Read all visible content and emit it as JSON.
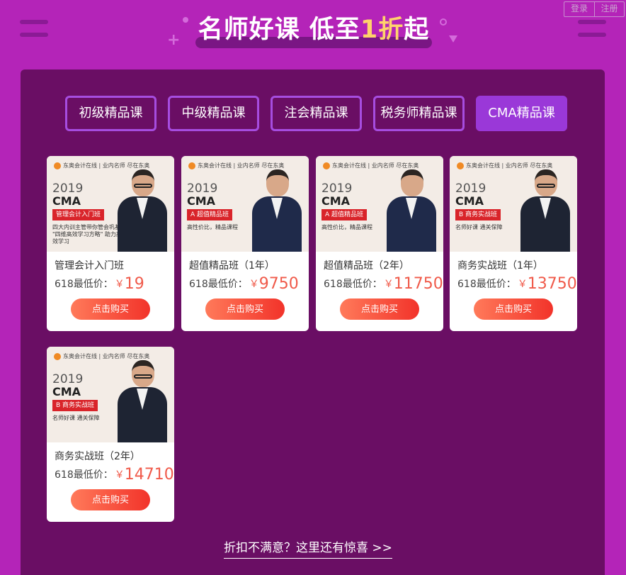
{
  "auth": {
    "login": "登录",
    "register": "注册"
  },
  "headline": {
    "part1": "名师好课 低至",
    "highlight": "1折",
    "part2": "起"
  },
  "tabs": [
    {
      "label": "初级精品课",
      "active": false
    },
    {
      "label": "中级精品课",
      "active": false
    },
    {
      "label": "注会精品课",
      "active": false
    },
    {
      "label": "税务师精品课",
      "active": false
    },
    {
      "label": "CMA精品课",
      "active": true
    }
  ],
  "thumb_common": {
    "logo": "东奥会计在线 | 业内名师 尽在东奥",
    "year": "2019",
    "cma": "CMA"
  },
  "cards": [
    {
      "ribbon": "管理会计入门班",
      "tagline": "四大内训主管带你管会巩基 \"四维高效学习方略\" 助力高效学习",
      "name": "管理会计入门班",
      "price_label": "618最低价：",
      "yen": "￥",
      "price": "19",
      "button": "点击购买"
    },
    {
      "ribbon": "A 超值精品班",
      "tagline": "高性价比，精品课程",
      "name": "超值精品班（1年）",
      "price_label": "618最低价：",
      "yen": "￥",
      "price": "9750",
      "button": "点击购买"
    },
    {
      "ribbon": "A 超值精品班",
      "tagline": "高性价比，精品课程",
      "name": "超值精品班（2年）",
      "price_label": "618最低价：",
      "yen": "￥",
      "price": "11750",
      "button": "点击购买"
    },
    {
      "ribbon": "B 商务实战班",
      "tagline": "名师好课 通关保障",
      "name": "商务实战班（1年）",
      "price_label": "618最低价：",
      "yen": "￥",
      "price": "13750",
      "button": "点击购买"
    },
    {
      "ribbon": "B 商务实战班",
      "tagline": "名师好课 通关保障",
      "name": "商务实战班（2年）",
      "price_label": "618最低价：",
      "yen": "￥",
      "price": "14710",
      "button": "点击购买"
    }
  ],
  "more_link": "折扣不满意？这里还有惊喜 >>"
}
